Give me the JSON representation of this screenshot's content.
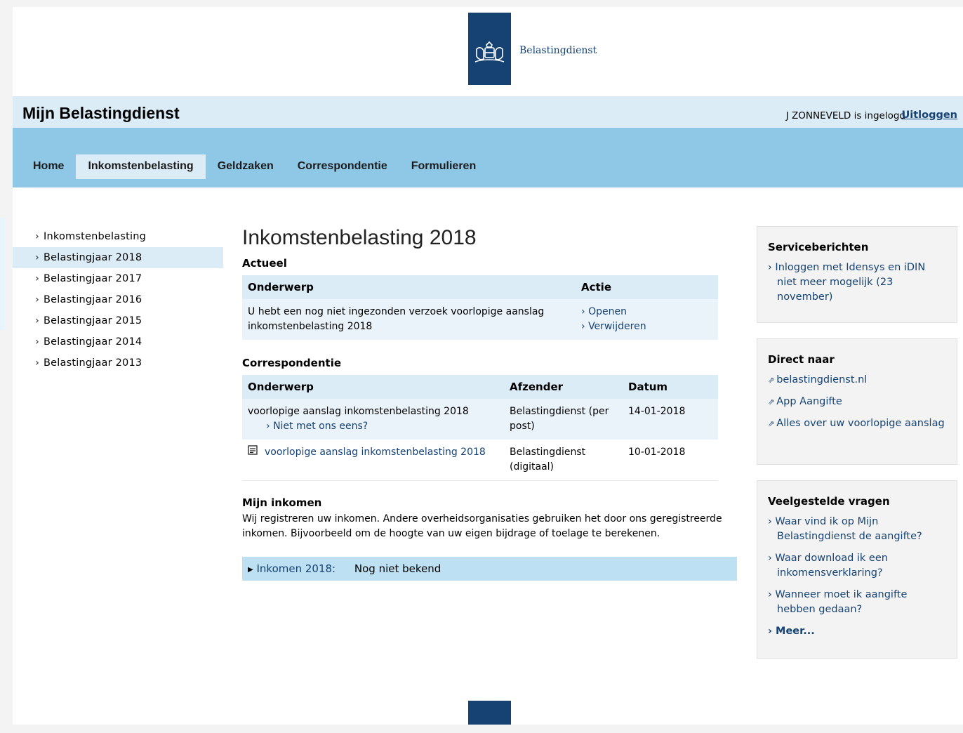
{
  "brand": {
    "name": "Belastingdienst"
  },
  "header": {
    "title": "Mijn Belastingdienst",
    "user_text": "J ZONNEVELD is ingelogd",
    "logout_label": "Uitloggen"
  },
  "nav": {
    "tabs": [
      {
        "label": "Home"
      },
      {
        "label": "Inkomstenbelasting"
      },
      {
        "label": "Geldzaken"
      },
      {
        "label": "Correspondentie"
      },
      {
        "label": "Formulieren"
      }
    ],
    "active": "Inkomstenbelasting"
  },
  "sidebar": {
    "items": [
      {
        "label": "Inkomstenbelasting"
      },
      {
        "label": "Belastingjaar 2018"
      },
      {
        "label": "Belastingjaar 2017"
      },
      {
        "label": "Belastingjaar 2016"
      },
      {
        "label": "Belastingjaar 2015"
      },
      {
        "label": "Belastingjaar 2014"
      },
      {
        "label": "Belastingjaar 2013"
      }
    ],
    "active": "Belastingjaar 2018"
  },
  "main": {
    "title": "Inkomstenbelasting 2018",
    "actueel": {
      "heading": "Actueel",
      "col_onderwerp": "Onderwerp",
      "col_actie": "Actie",
      "row_text": "U hebt een nog niet ingezonden verzoek voorlopige aanslag inkomstenbelasting 2018",
      "action_open": "Openen",
      "action_delete": "Verwijderen"
    },
    "correspondentie": {
      "heading": "Correspondentie",
      "col_onderwerp": "Onderwerp",
      "col_afzender": "Afzender",
      "col_datum": "Datum",
      "rows": [
        {
          "onderwerp": "voorlopige aanslag inkomstenbelasting 2018",
          "sublink": "Niet met ons eens?",
          "afzender": "Belastingdienst (per post)",
          "datum": "14-01-2018"
        },
        {
          "onderwerp": "voorlopige aanslag inkomstenbelasting 2018",
          "afzender": "Belastingdienst (digitaal)",
          "datum": "10-01-2018",
          "icon": "document-icon"
        }
      ]
    },
    "inkomen": {
      "heading": "Mijn inkomen",
      "text": "Wij registreren uw inkomen. Andere overheidsorganisaties gebruiken het door ons geregistreerde inkomen. Bijvoorbeeld om de hoogte van uw eigen bijdrage of toelage te berekenen.",
      "bar_label": "Inkomen 2018:",
      "bar_value": "Nog niet bekend"
    }
  },
  "right": {
    "service": {
      "title": "Serviceberichten",
      "links": [
        "Inloggen met Idensys en iDIN niet meer mogelijk (23 november)"
      ]
    },
    "direct": {
      "title": "Direct naar",
      "links": [
        "belastingdienst.nl",
        "App Aangifte",
        "Alles over uw voorlopige aanslag"
      ]
    },
    "faq": {
      "title": "Veelgestelde vragen",
      "links": [
        "Waar vind ik op Mijn Belastingdienst de aangifte?",
        "Waar download ik een inkomensverklaring?",
        "Wanneer moet ik aangifte hebben gedaan?"
      ],
      "more": "Meer..."
    }
  },
  "colors": {
    "brand_blue": "#154273",
    "nav_blue": "#8fc8e7",
    "light_blue": "#dcecf6",
    "bar_blue": "#bde0f2"
  }
}
